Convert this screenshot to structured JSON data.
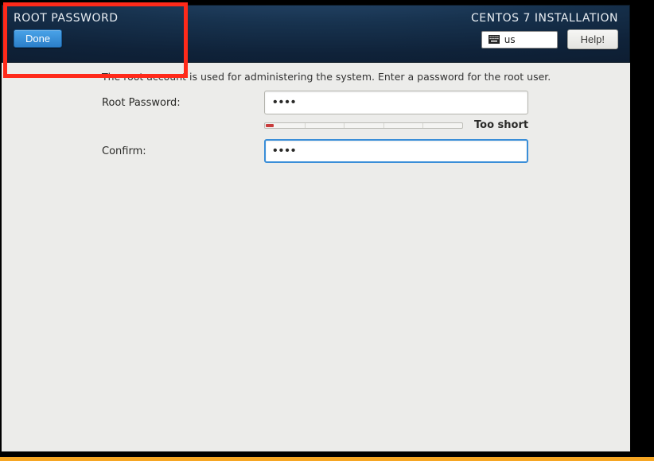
{
  "header": {
    "page_title": "ROOT PASSWORD",
    "done_label": "Done",
    "installer_title": "CENTOS 7 INSTALLATION",
    "keyboard_layout": "us",
    "help_label": "Help!"
  },
  "content": {
    "intro_text": "The root account is used for administering the system.  Enter a password for the root user.",
    "root_password_label": "Root Password:",
    "confirm_label": "Confirm:",
    "root_password_value": "••••",
    "confirm_value": "••••",
    "strength_text": "Too short",
    "strength_fill_percent": 4
  },
  "colors": {
    "header_gradient_top": "#2b4e74",
    "header_gradient_bottom": "#0c1b2e",
    "content_bg": "#ececea",
    "accent_blue": "#3a8ed8",
    "highlight_red": "#ff2a1a",
    "warning_bar": "#f6a623"
  }
}
